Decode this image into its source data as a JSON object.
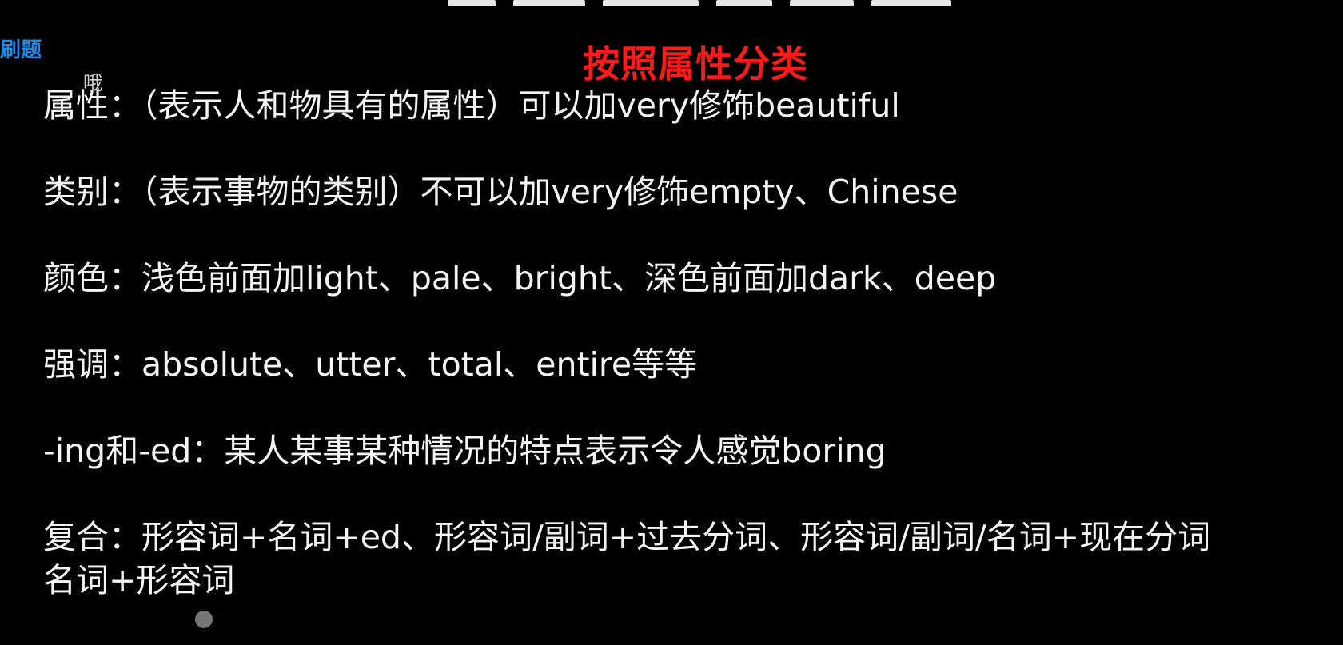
{
  "side_link": "刷题",
  "page_title": "按照属性分类",
  "danmaku": "哦",
  "lines": [
    "属性：（表示人和物具有的属性）可以加very修饰beautiful",
    "类别：（表示事物的类别）不可以加very修饰empty、Chinese",
    "颜色：浅色前面加light、pale、bright、深色前面加dark、deep",
    "强调：absolute、utter、total、entire等等",
    "-ing和-ed：某人某事某种情况的特点表示令人感觉boring",
    "复合：形容词+名词+ed、形容词/副词+过去分词、形容词/副词/名词+现在分词"
  ],
  "lines_continuation": "名词+形容词"
}
